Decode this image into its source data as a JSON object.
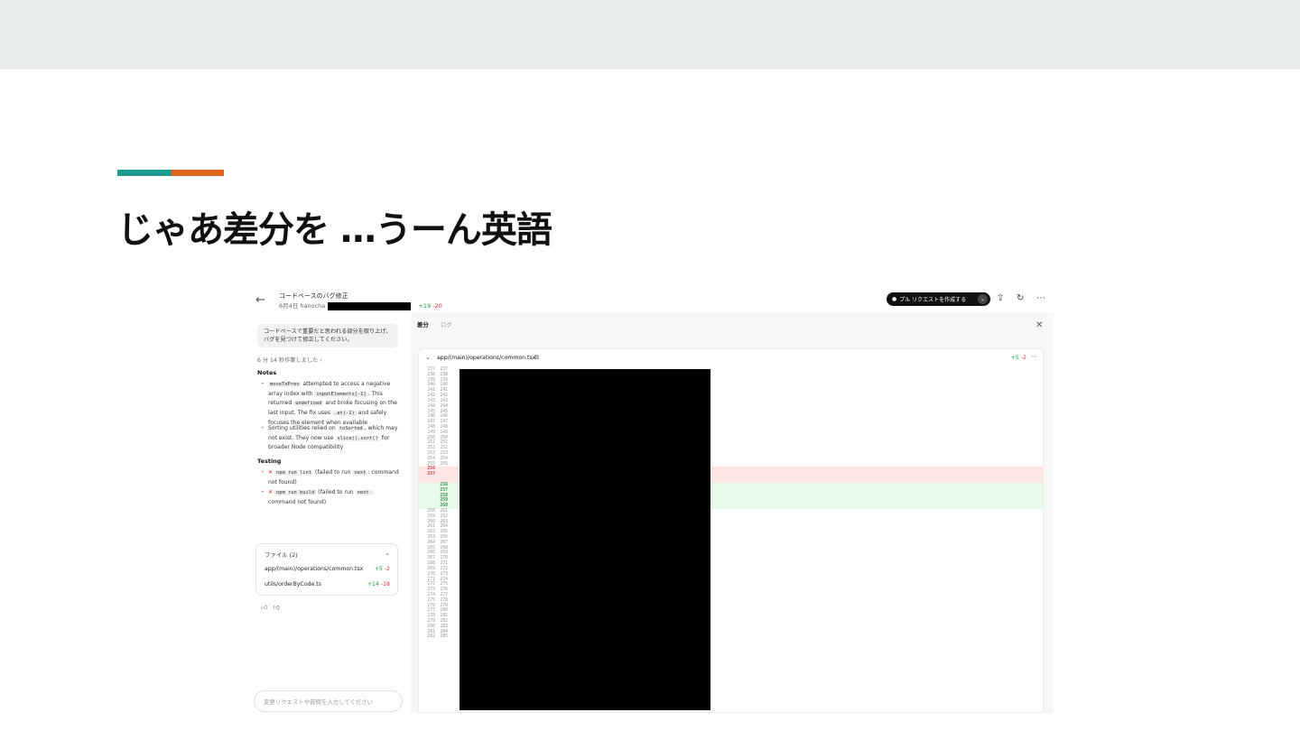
{
  "slide": {
    "title": "じゃあ差分を …うーん英語"
  },
  "header": {
    "back_icon": "arrow-left-icon",
    "task_title": "コードベースのバグ修正",
    "date": "6月4日",
    "user": "hanocha",
    "additions": "+19",
    "deletions": "-20",
    "pr_button_label": "プル リクエストを作成する"
  },
  "left": {
    "prompt": "コードベースで重要だと思われる部分を取り上げ、バグを見つけて修正してください。",
    "worked_time": "6 分 14 秒作業しました ›",
    "notes_heading": "Notes",
    "notes": [
      {
        "code1": "moveToPrev",
        "t1": " attempted to access a negative array index with ",
        "code2": "inputElements[-1]",
        "t2": ". This returned ",
        "code3": "undefined",
        "t3": " and broke focusing on the last input. The fix uses ",
        "code4": ".at(-1)",
        "t4": " and safely focuses the element when available"
      },
      {
        "t1": "Sorting utilities relied on ",
        "code1": "toSorted",
        "t2": ", which may not exist. They now use ",
        "code2": "slice().sort()",
        "t3": " for broader Node compatibility"
      }
    ],
    "testing_heading": "Testing",
    "tests": [
      {
        "status": "✕",
        "cmd": "npm run lint",
        "t1": " (failed to run ",
        "code": "next",
        "t2": ": command not found)"
      },
      {
        "status": "✕",
        "cmd": "npm run build",
        "t1": " (failed to run ",
        "code": "next",
        "t2": ": command not found)"
      }
    ],
    "files_heading": "ファイル (2)",
    "files": [
      {
        "path": "app/(main)/operations/common.tsx",
        "add": "+5",
        "del": "-2"
      },
      {
        "path": "utils/orderByCode.ts",
        "add": "+14",
        "del": "-18"
      }
    ],
    "input_placeholder": "変更リクエストや質問を入力してください"
  },
  "right": {
    "tab_diff": "差分",
    "tab_log": "ログ",
    "file_path": "app/(main)/operations/common.tsx",
    "file_add": "+5",
    "file_del": "-2"
  },
  "diff_lines": [
    {
      "o": "237",
      "n": "237",
      "k": "ctx"
    },
    {
      "o": "238",
      "n": "238",
      "k": "ctx"
    },
    {
      "o": "239",
      "n": "239",
      "k": "ctx"
    },
    {
      "o": "240",
      "n": "240",
      "k": "ctx"
    },
    {
      "o": "241",
      "n": "241",
      "k": "ctx"
    },
    {
      "o": "242",
      "n": "242",
      "k": "ctx"
    },
    {
      "o": "243",
      "n": "243",
      "k": "ctx"
    },
    {
      "o": "244",
      "n": "244",
      "k": "ctx"
    },
    {
      "o": "245",
      "n": "245",
      "k": "ctx"
    },
    {
      "o": "246",
      "n": "246",
      "k": "ctx"
    },
    {
      "o": "247",
      "n": "247",
      "k": "ctx"
    },
    {
      "o": "248",
      "n": "248",
      "k": "ctx"
    },
    {
      "o": "249",
      "n": "249",
      "k": "ctx"
    },
    {
      "o": "250",
      "n": "250",
      "k": "ctx"
    },
    {
      "o": "251",
      "n": "251",
      "k": "ctx"
    },
    {
      "o": "252",
      "n": "252",
      "k": "ctx"
    },
    {
      "o": "253",
      "n": "253",
      "k": "ctx"
    },
    {
      "o": "254",
      "n": "254",
      "k": "ctx"
    },
    {
      "o": "255",
      "n": "255",
      "k": "ctx"
    },
    {
      "o": "256",
      "n": "",
      "k": "del"
    },
    {
      "o": "257",
      "n": "",
      "k": "del"
    },
    {
      "o": "",
      "n": "",
      "k": "del"
    },
    {
      "o": "",
      "n": "256",
      "k": "add"
    },
    {
      "o": "",
      "n": "257",
      "k": "add"
    },
    {
      "o": "",
      "n": "258",
      "k": "add"
    },
    {
      "o": "",
      "n": "259",
      "k": "add"
    },
    {
      "o": "",
      "n": "260",
      "k": "add"
    },
    {
      "o": "258",
      "n": "261",
      "k": "ctx"
    },
    {
      "o": "259",
      "n": "262",
      "k": "ctx"
    },
    {
      "o": "260",
      "n": "263",
      "k": "ctx"
    },
    {
      "o": "261",
      "n": "264",
      "k": "ctx"
    },
    {
      "o": "262",
      "n": "265",
      "k": "ctx"
    },
    {
      "o": "263",
      "n": "266",
      "k": "ctx"
    },
    {
      "o": "264",
      "n": "267",
      "k": "ctx"
    },
    {
      "o": "265",
      "n": "268",
      "k": "ctx"
    },
    {
      "o": "266",
      "n": "269",
      "k": "ctx"
    },
    {
      "o": "267",
      "n": "270",
      "k": "ctx"
    },
    {
      "o": "268",
      "n": "271",
      "k": "ctx"
    },
    {
      "o": "269",
      "n": "272",
      "k": "ctx"
    },
    {
      "o": "270",
      "n": "273",
      "k": "ctx"
    },
    {
      "o": "271",
      "n": "274",
      "k": "ctx"
    },
    {
      "o": "272",
      "n": "275",
      "k": "ctx"
    },
    {
      "o": "273",
      "n": "276",
      "k": "ctx"
    },
    {
      "o": "274",
      "n": "277",
      "k": "ctx"
    },
    {
      "o": "275",
      "n": "278",
      "k": "ctx"
    },
    {
      "o": "276",
      "n": "279",
      "k": "ctx"
    },
    {
      "o": "277",
      "n": "280",
      "k": "ctx"
    },
    {
      "o": "278",
      "n": "281",
      "k": "ctx"
    },
    {
      "o": "279",
      "n": "282",
      "k": "ctx"
    },
    {
      "o": "280",
      "n": "283",
      "k": "ctx"
    },
    {
      "o": "281",
      "n": "284",
      "k": "ctx"
    },
    {
      "o": "282",
      "n": "285",
      "k": "ctx"
    }
  ],
  "colors": {
    "accent_teal": "#1f9a8e",
    "accent_orange": "#e0641b",
    "add_green": "#1f9d3f",
    "del_red": "#d33333"
  }
}
